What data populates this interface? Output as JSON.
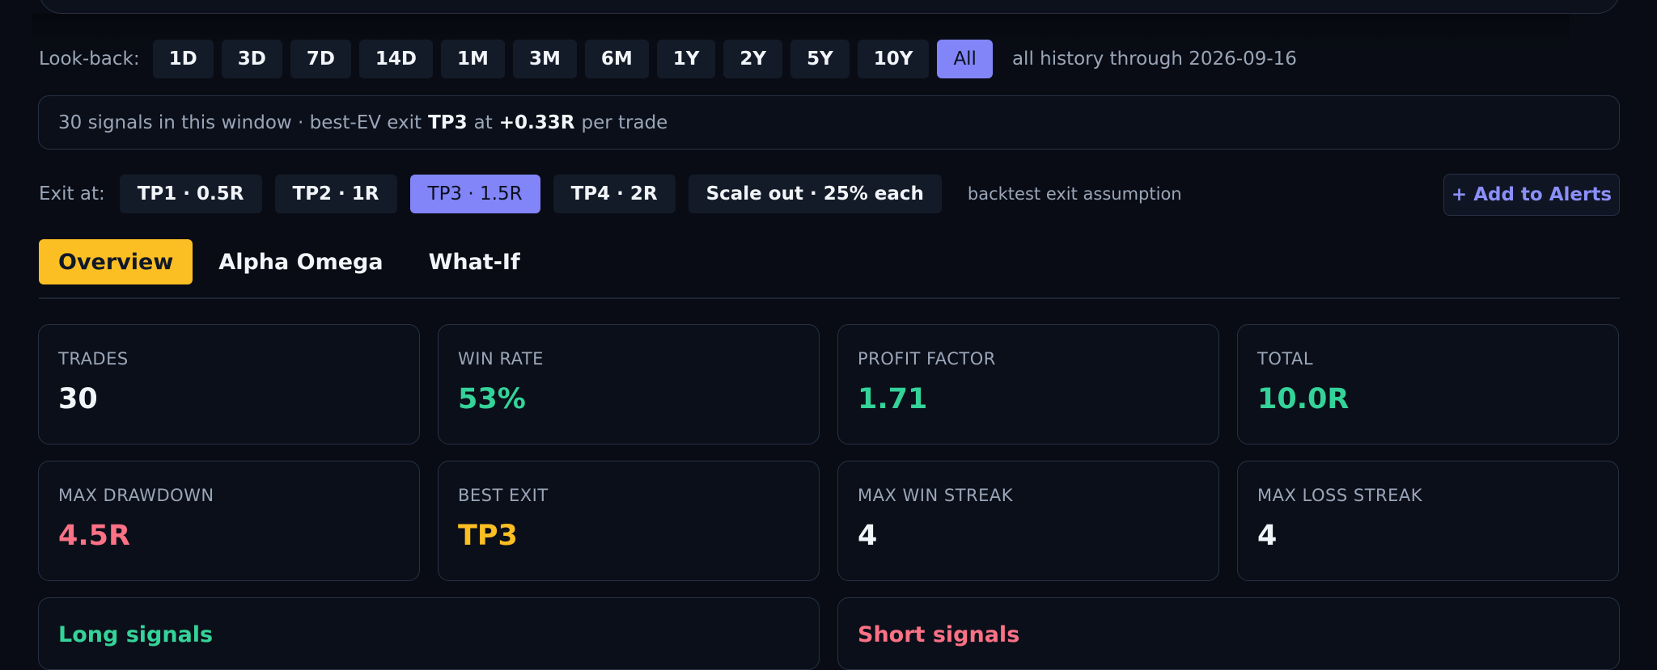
{
  "lookback": {
    "label": "Look-back:",
    "options": [
      "1D",
      "3D",
      "7D",
      "14D",
      "1M",
      "3M",
      "6M",
      "1Y",
      "2Y",
      "5Y",
      "10Y",
      "All"
    ],
    "selected": "All",
    "hint": "all history through 2026-09-16"
  },
  "summary": {
    "prefix": "30 signals in this window · best-EV exit",
    "exit": "TP3",
    "mid": "at",
    "ev": "+0.33R",
    "suffix": "per trade"
  },
  "exit_at": {
    "label": "Exit at:",
    "options": [
      "TP1 · 0.5R",
      "TP2 · 1R",
      "TP3 · 1.5R",
      "TP4 · 2R",
      "Scale out · 25% each"
    ],
    "selected": "TP3 · 1.5R",
    "hint": "backtest exit assumption",
    "alerts_button": "+ Add to Alerts"
  },
  "tabs": [
    "Overview",
    "Alpha Omega",
    "What-If"
  ],
  "active_tab": "Overview",
  "stats": [
    {
      "label": "TRADES",
      "value": "30",
      "color": "#f1f5f9"
    },
    {
      "label": "WIN RATE",
      "value": "53%",
      "color": "#34d399"
    },
    {
      "label": "PROFIT FACTOR",
      "value": "1.71",
      "color": "#34d399"
    },
    {
      "label": "TOTAL",
      "value": "10.0R",
      "color": "#34d399"
    },
    {
      "label": "MAX DRAWDOWN",
      "value": "4.5R",
      "color": "#fb7185"
    },
    {
      "label": "BEST EXIT",
      "value": "TP3",
      "color": "#fbbf24"
    },
    {
      "label": "MAX WIN STREAK",
      "value": "4",
      "color": "#f1f5f9"
    },
    {
      "label": "MAX LOSS STREAK",
      "value": "4",
      "color": "#f1f5f9"
    }
  ],
  "sections": {
    "long_title": "Long signals",
    "short_title": "Short signals"
  }
}
